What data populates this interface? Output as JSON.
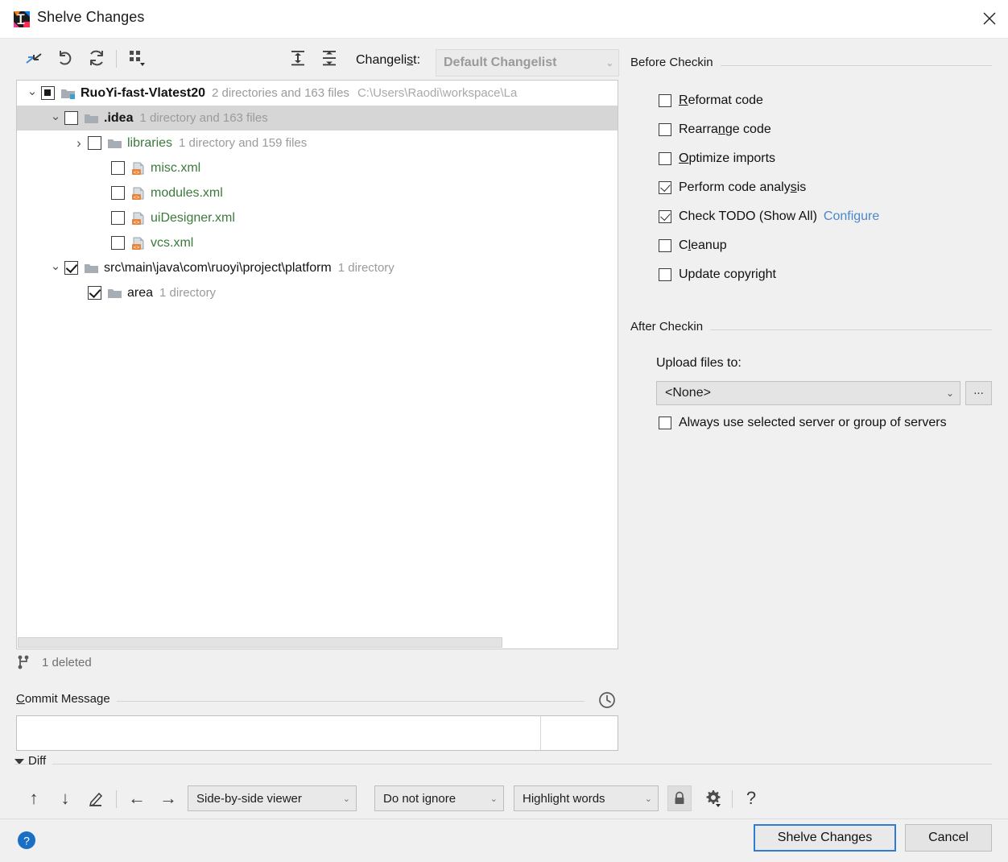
{
  "window": {
    "title": "Shelve Changes",
    "app_icon": "intellij-idea-icon",
    "close_label": "✕"
  },
  "toolbar": {
    "buttons": [
      {
        "name": "shelve-silently-icon",
        "tooltip": "Shelve Silently"
      },
      {
        "name": "revert-icon",
        "tooltip": "Revert"
      },
      {
        "name": "refresh-icon",
        "tooltip": "Refresh"
      },
      {
        "name": "group-by-icon",
        "tooltip": "Group By"
      },
      {
        "name": "expand-all-icon",
        "tooltip": "Expand All"
      },
      {
        "name": "collapse-all-icon",
        "tooltip": "Collapse All"
      }
    ],
    "changelist_label": "Changelist:",
    "changelist_mnemonic": "s",
    "changelist_value": "Default Changelist",
    "changelist_arrow": "⌄"
  },
  "tree": {
    "rows": [
      {
        "indent": 0,
        "twisty": "expanded",
        "check": "partial",
        "icon": "module-folder-icon",
        "name": "RuoYi-fast-Vlatest20",
        "name_style": "dark bold",
        "meta": "2 directories and 163 files",
        "path": "C:\\Users\\Raodi\\workspace\\La",
        "selected": false
      },
      {
        "indent": 1,
        "twisty": "expanded",
        "check": "unchecked",
        "icon": "folder-icon",
        "name": ".idea",
        "name_style": "dark bold",
        "meta": "1 directory and 163 files",
        "path": "",
        "selected": true
      },
      {
        "indent": 2,
        "twisty": "collapsed",
        "check": "unchecked",
        "icon": "folder-icon",
        "name": "libraries",
        "name_style": "green",
        "meta": "1 directory and 159 files",
        "path": "",
        "selected": false
      },
      {
        "indent": 3,
        "twisty": "none",
        "check": "unchecked",
        "icon": "xml-file-icon",
        "name": "misc.xml",
        "name_style": "green",
        "meta": "",
        "path": "",
        "selected": false
      },
      {
        "indent": 3,
        "twisty": "none",
        "check": "unchecked",
        "icon": "xml-file-icon",
        "name": "modules.xml",
        "name_style": "green",
        "meta": "",
        "path": "",
        "selected": false
      },
      {
        "indent": 3,
        "twisty": "none",
        "check": "unchecked",
        "icon": "xml-file-icon",
        "name": "uiDesigner.xml",
        "name_style": "green",
        "meta": "",
        "path": "",
        "selected": false
      },
      {
        "indent": 3,
        "twisty": "none",
        "check": "unchecked",
        "icon": "xml-file-icon",
        "name": "vcs.xml",
        "name_style": "green",
        "meta": "",
        "path": "",
        "selected": false
      },
      {
        "indent": 1,
        "twisty": "expanded",
        "check": "checked",
        "icon": "folder-icon",
        "name": "src\\main\\java\\com\\ruoyi\\project\\platform",
        "name_style": "dark",
        "meta": "1 directory",
        "path": "",
        "selected": false
      },
      {
        "indent": 2,
        "twisty": "none",
        "check": "checked",
        "icon": "folder-icon",
        "name": "area",
        "name_style": "dark",
        "meta": "1 directory",
        "path": "",
        "selected": false
      }
    ],
    "scrollbar": {
      "name": "horizontal-scrollbar"
    }
  },
  "status": {
    "icon": "vcs-branch-icon",
    "text": "1 deleted"
  },
  "commit_message": {
    "title": "Commit Message",
    "mnemonic": "C",
    "value": "",
    "placeholder": "",
    "history_icon": "clock-icon"
  },
  "diff": {
    "section_label": "Diff",
    "expanded": true,
    "buttons": [
      {
        "name": "previous-difference-icon",
        "glyph": "↑"
      },
      {
        "name": "next-difference-icon",
        "glyph": "↓"
      },
      {
        "name": "edit-source-icon",
        "glyph": "✎"
      },
      {
        "name": "accept-left-icon",
        "glyph": "←"
      },
      {
        "name": "accept-right-icon",
        "glyph": "→"
      }
    ],
    "viewer_mode": "Side-by-side viewer",
    "whitespace_mode": "Do not ignore",
    "highlight_mode": "Highlight words",
    "lock_icon": "lock-icon",
    "settings_icon": "gear-icon",
    "help_icon": "question-mark-icon",
    "arrow": "⌄"
  },
  "before_checkin": {
    "title": "Before Checkin",
    "items": [
      {
        "label": "Reformat code",
        "mnemonic": "R",
        "checked": false,
        "name": "reformat-code-checkbox"
      },
      {
        "label": "Rearrange code",
        "mnemonic": "n",
        "checked": false,
        "name": "rearrange-code-checkbox"
      },
      {
        "label": "Optimize imports",
        "mnemonic": "O",
        "checked": false,
        "name": "optimize-imports-checkbox"
      },
      {
        "label": "Perform code analysis",
        "mnemonic": "s",
        "checked": true,
        "name": "perform-code-analysis-checkbox"
      },
      {
        "label": "Check TODO (Show All)",
        "mnemonic": "",
        "checked": true,
        "name": "check-todo-checkbox",
        "link": "Configure"
      },
      {
        "label": "Cleanup",
        "mnemonic": "l",
        "checked": false,
        "name": "cleanup-checkbox"
      },
      {
        "label": "Update copyright",
        "mnemonic": "",
        "checked": false,
        "name": "update-copyright-checkbox"
      }
    ]
  },
  "after_checkin": {
    "title": "After Checkin",
    "upload_label": "Upload files to:",
    "upload_value": "<None>",
    "upload_arrow": "⌄",
    "browse_label": "...",
    "always_use_label": "Always use selected server or group of servers",
    "always_use_checked": false
  },
  "footer": {
    "help_icon": "help-icon",
    "primary_button": "Shelve Changes",
    "cancel_button": "Cancel"
  },
  "colors": {
    "accent": "#2f7cd4",
    "link": "#4a88c7",
    "file_green": "#3b7a3b",
    "meta_gray": "#9b9b9b",
    "selection": "#d6d6d6",
    "background": "#f0f0f0"
  }
}
